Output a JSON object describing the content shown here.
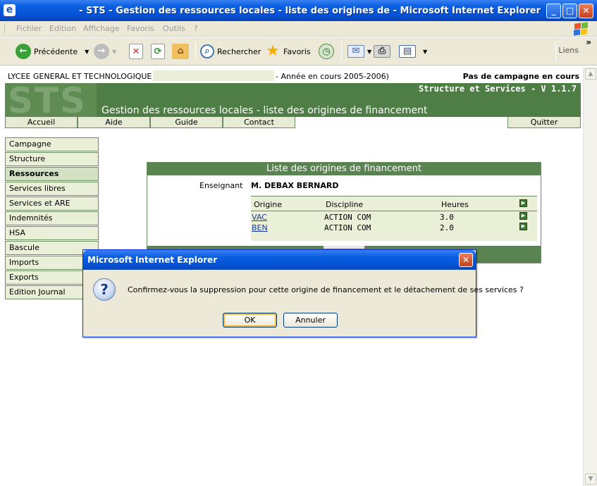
{
  "window": {
    "title": "- STS - Gestion des ressources locales - liste des origines de - Microsoft Internet Explorer",
    "minimize": "_",
    "maximize": "□",
    "close": "✕"
  },
  "menu": [
    "Fichier",
    "Edition",
    "Affichage",
    "Favoris",
    "Outils",
    "?"
  ],
  "toolbar": {
    "back_label": "Précédente",
    "search_label": "Rechercher",
    "favorites_label": "Favoris",
    "links_label": "Liens",
    "chevron": "»"
  },
  "page": {
    "school": "LYCEE GENERAL ET TECHNOLOGIQUE",
    "year": "- Année en cours 2005-2006)",
    "campaign_status": "Pas de campagne en cours",
    "version": "Structure et Services - V 1.1.7",
    "logo": "STS",
    "heading": "Gestion des ressources locales - liste des origines de financement",
    "nav": [
      "Accueil",
      "Aide",
      "Guide",
      "Contact"
    ],
    "quit": "Quitter"
  },
  "sidebar": {
    "items": [
      "Campagne",
      "Structure",
      "Ressources",
      "Services libres",
      "Services et ARE",
      "Indemnités",
      "HSA",
      "Bascule",
      "Imports",
      "Exports",
      "Edition Journal"
    ],
    "active": "Ressources"
  },
  "panel": {
    "title": "Liste des origines de financement",
    "teacher_label": "Enseignant",
    "teacher_name": "M. DEBAX BERNARD",
    "columns": [
      "Origine",
      "Discipline",
      "Heures"
    ],
    "rows": [
      {
        "origine": "VAC",
        "discipline": "ACTION COM",
        "heures": "3.0"
      },
      {
        "origine": "BEN",
        "discipline": "ACTION COM",
        "heures": "2.0"
      }
    ]
  },
  "dialog": {
    "title": "Microsoft Internet Explorer",
    "message": "Confirmez-vous la suppression pour cette origine de financement et le détachement de ses services ?",
    "ok": "OK",
    "cancel": "Annuler",
    "icon": "question-icon"
  }
}
